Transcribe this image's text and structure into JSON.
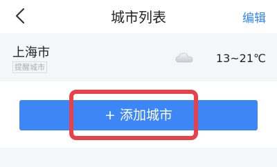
{
  "header": {
    "title": "城市列表",
    "edit_label": "编辑",
    "back_icon": "chevron-left-icon"
  },
  "city_list": [
    {
      "name": "上海市",
      "tag": "提醒城市",
      "weather_icon": "cloud-icon",
      "temperature": "13~21℃"
    }
  ],
  "add_button": {
    "label": "+ 添加城市"
  },
  "colors": {
    "accent": "#3d86f6",
    "highlight": "#e8414a",
    "card_bg": "#f4f6f8"
  }
}
